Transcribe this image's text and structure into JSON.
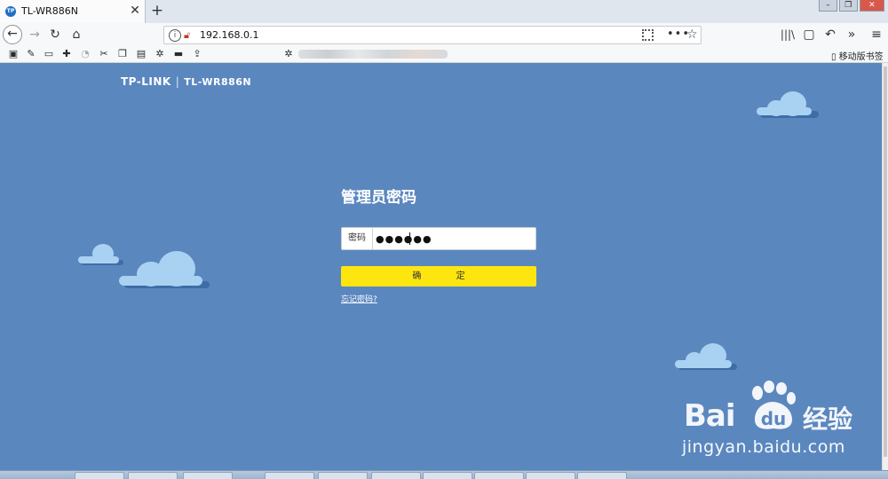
{
  "browser": {
    "tab": {
      "title": "TL-WR886N",
      "favicon_text": "TP"
    },
    "new_tab_label": "+",
    "url": "192.168.0.1",
    "bookmarks_bar": {
      "mobile_bookmarks": "移动版书签"
    },
    "icons": [
      "back-icon",
      "forward-icon",
      "reload-icon",
      "home-icon",
      "info-icon",
      "insecure-icon",
      "qr-code-icon",
      "more-icon",
      "star-icon",
      "library-icon",
      "sidebar-icon",
      "undo-icon",
      "overflow-icon",
      "menu-icon"
    ]
  },
  "page": {
    "brand": {
      "logo": "TP-LINK",
      "separator": "|",
      "model": "TL-WR886N"
    },
    "login": {
      "title": "管理员密码",
      "password_label": "密码",
      "password_value": "●●●●●●",
      "confirm_button": "确 定",
      "forgot_link": "忘记密码?"
    },
    "watermark": {
      "brand": "Bai",
      "product": "经验",
      "url": "jingyan.baidu.com"
    }
  },
  "colors": {
    "page_background": "#5b87bf",
    "cloud": "#a9d2f2",
    "confirm_button": "#fde50f",
    "text_on_page": "#ffffff"
  }
}
